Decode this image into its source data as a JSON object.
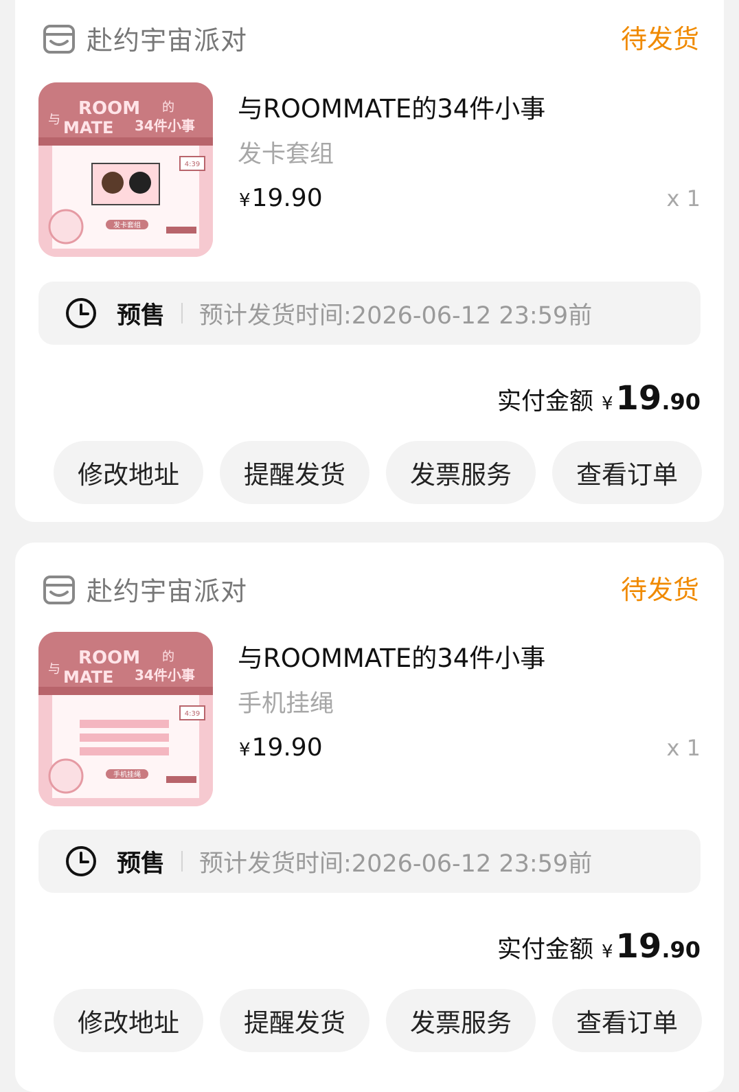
{
  "orders": [
    {
      "shop_name": "赴约宇宙派对",
      "status": "待发货",
      "product_title": "与ROOMMATE的34件小事",
      "spec": "发卡套组",
      "price_symbol": "¥",
      "price": "19.90",
      "quantity": "x 1",
      "thumb_tag": "发卡套组",
      "thumb_clock": "4:39",
      "presale_label": "预售",
      "presale_time": "预计发货时间:2026-06-12 23:59前",
      "paid_label": "实付金额",
      "paid_symbol": "¥",
      "paid_int": "19",
      "paid_dec": ".90",
      "actions": [
        "修改地址",
        "提醒发货",
        "发票服务",
        "查看订单"
      ]
    },
    {
      "shop_name": "赴约宇宙派对",
      "status": "待发货",
      "product_title": "与ROOMMATE的34件小事",
      "spec": "手机挂绳",
      "price_symbol": "¥",
      "price": "19.90",
      "quantity": "x 1",
      "thumb_tag": "手机挂绳",
      "thumb_clock": "4:39",
      "presale_label": "预售",
      "presale_time": "预计发货时间:2026-06-12 23:59前",
      "paid_label": "实付金额",
      "paid_symbol": "¥",
      "paid_int": "19",
      "paid_dec": ".90",
      "actions": [
        "修改地址",
        "提醒发货",
        "发票服务",
        "查看订单"
      ]
    }
  ],
  "thumb_banner_lines": [
    "ROOM",
    "MATE",
    "与",
    "的",
    "34件小事"
  ],
  "colors": {
    "status": "#f08a00",
    "background": "#f2f2f2",
    "card": "#ffffff",
    "chip": "#f3f3f3",
    "thumb_pink": "#f6c9d0",
    "thumb_roof": "#c97a80"
  },
  "icons": [
    "shop-icon",
    "clock-icon"
  ]
}
